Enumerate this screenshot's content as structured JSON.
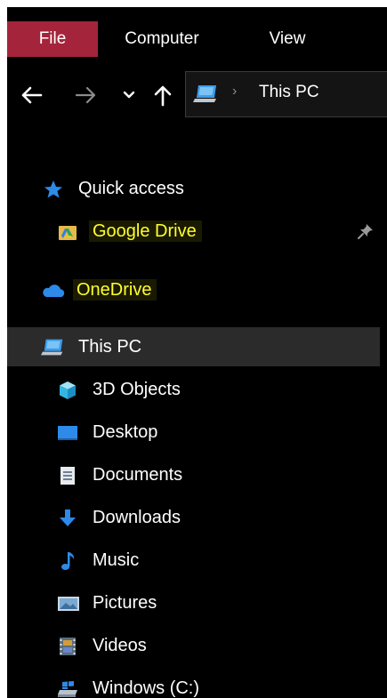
{
  "ribbon": {
    "tabs": [
      {
        "label": "File",
        "active": true
      },
      {
        "label": "Computer",
        "active": false
      },
      {
        "label": "View",
        "active": false
      }
    ]
  },
  "address": {
    "path": "This PC"
  },
  "nav": {
    "quick_access": "Quick access",
    "google_drive": "Google Drive",
    "onedrive": "OneDrive",
    "this_pc": "This PC",
    "children": [
      {
        "label": "3D Objects",
        "icon": "cube-icon"
      },
      {
        "label": "Desktop",
        "icon": "desktop-icon"
      },
      {
        "label": "Documents",
        "icon": "document-icon"
      },
      {
        "label": "Downloads",
        "icon": "download-arrow-icon"
      },
      {
        "label": "Music",
        "icon": "music-note-icon"
      },
      {
        "label": "Pictures",
        "icon": "pictures-icon"
      },
      {
        "label": "Videos",
        "icon": "film-icon"
      },
      {
        "label": "Windows (C:)",
        "icon": "drive-icon"
      }
    ]
  },
  "colors": {
    "file_tab": "#a4243b",
    "highlight_text": "#ffff2e",
    "selected_bg": "#2b2b2b",
    "accent_blue": "#2d8ae8"
  }
}
